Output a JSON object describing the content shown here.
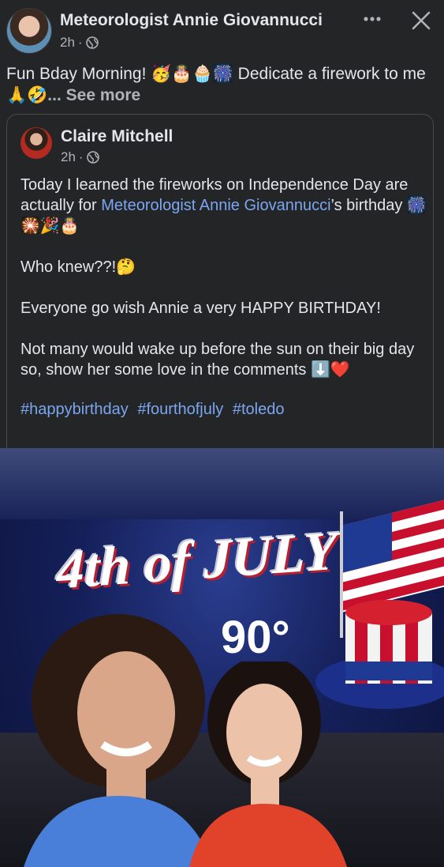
{
  "header": {
    "author": "Meteorologist Annie Giovannucci",
    "time": "2h",
    "privacy_icon": "globe-icon",
    "more_icon": "more-horizontal-icon",
    "close_icon": "close-icon"
  },
  "post": {
    "text": "Fun Bday Morning! 🥳🎂🧁🎆 Dedicate a firework to me 🙏🤣",
    "see_more": "... See more"
  },
  "shared_post": {
    "author": "Claire Mitchell",
    "time": "2h",
    "line1_before": "Today I learned the fireworks on Independence Day are actually for ",
    "mention": "Meteorologist Annie Giovannucci",
    "line1_after": "’s birthday 🎆🎇🎉🎂",
    "para2": "Who knew??!🤔",
    "para3": "Everyone go wish Annie a very HAPPY BIRTHDAY!",
    "para4": "Not many would wake up before the sun on their big day so, show her some love in the comments ⬇️❤️",
    "hashtags": [
      "#happybirthday",
      "#fourthofjuly",
      "#toledo"
    ]
  },
  "photo": {
    "banner_title": "4th of JULY",
    "temperature": "90°"
  },
  "colors": {
    "background": "#242526",
    "text": "#e4e6eb",
    "secondary": "#b0b3b8",
    "link": "#7aa6f2"
  }
}
